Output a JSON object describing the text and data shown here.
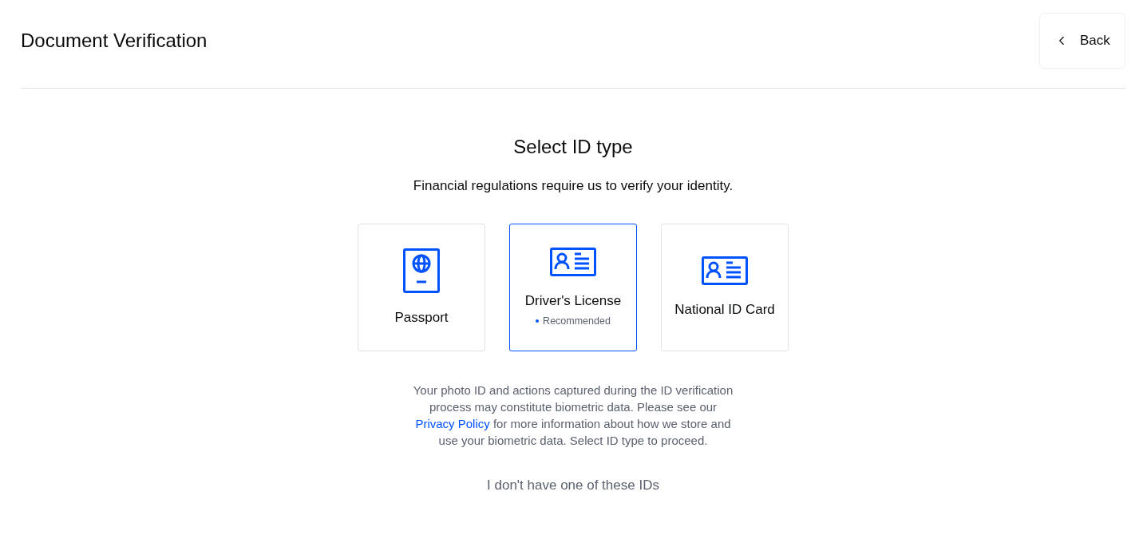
{
  "header": {
    "title": "Document Verification",
    "back_button": "Back"
  },
  "main": {
    "heading": "Select ID type",
    "subtitle": "Financial regulations require us to verify your identity."
  },
  "id_types": [
    {
      "kind": "passport",
      "label": "Passport",
      "selected": false
    },
    {
      "kind": "id-card",
      "label": "Driver's License",
      "selected": true,
      "badge": "Recommended"
    },
    {
      "kind": "id-card",
      "label": "National ID Card",
      "selected": false
    }
  ],
  "disclaimer": {
    "before": "Your photo ID and actions captured during the ID verification process may constitute biometric data. Please see our",
    "link": "Privacy Policy",
    "after": "for more information about how we store and use your biometric data. Select ID type to proceed."
  },
  "no_id_link": "I don't have one of these IDs"
}
